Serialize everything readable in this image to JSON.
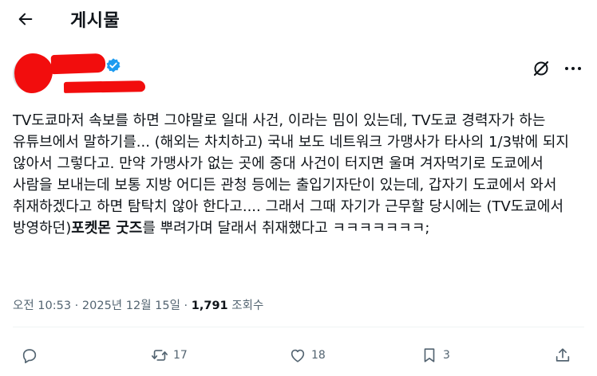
{
  "header": {
    "title": "게시물"
  },
  "icons": {
    "back": "arrow-left-icon",
    "verified": "verified-badge-icon",
    "grok": "grok-icon",
    "more": "more-horizontal-icon",
    "reply": "reply-icon",
    "retweet": "retweet-icon",
    "like": "heart-icon",
    "bookmark": "bookmark-icon",
    "share": "share-icon"
  },
  "colors": {
    "verified": "#1d9bf0",
    "redaction": "#f20d0d",
    "muted": "#536471"
  },
  "tweet": {
    "text_part1": "TV도쿄마저 속보를 하면 그야말로 일대 사건, 이라는 밈이 있는데, TV도쿄 경력자가 하는 유튜브에서 말하기를... (해외는 차치하고) 국내 보도 네트워크 가맹사가 타사의 1/3밖에 되지 않아서 그렇다고. 만약 가맹사가 없는 곳에 중대 사건이 터지면 울며 겨자먹기로 도쿄에서 사람을 보내는데 보통 지방 어디든 관청 등에는 출입기자단이 있는데, 갑자기 도쿄에서 와서 취재하겠다고 하면 탐탁치 않아 한다고.... 그래서 그때 자기가 근무할 당시에는 (TV도쿄에서 방영하던)",
    "text_bold": "포켓몬 굿즈",
    "text_part2": "를 뿌려가며 달래서 취재했다고 ㅋㅋㅋㅋㅋㅋㅋ;"
  },
  "meta": {
    "time": "오전 10:53",
    "sep": " · ",
    "date": "2025년 12월 15일",
    "views": "1,791",
    "views_label": "조회수"
  },
  "actions": {
    "retweets": "17",
    "likes": "18",
    "bookmarks": "3"
  }
}
